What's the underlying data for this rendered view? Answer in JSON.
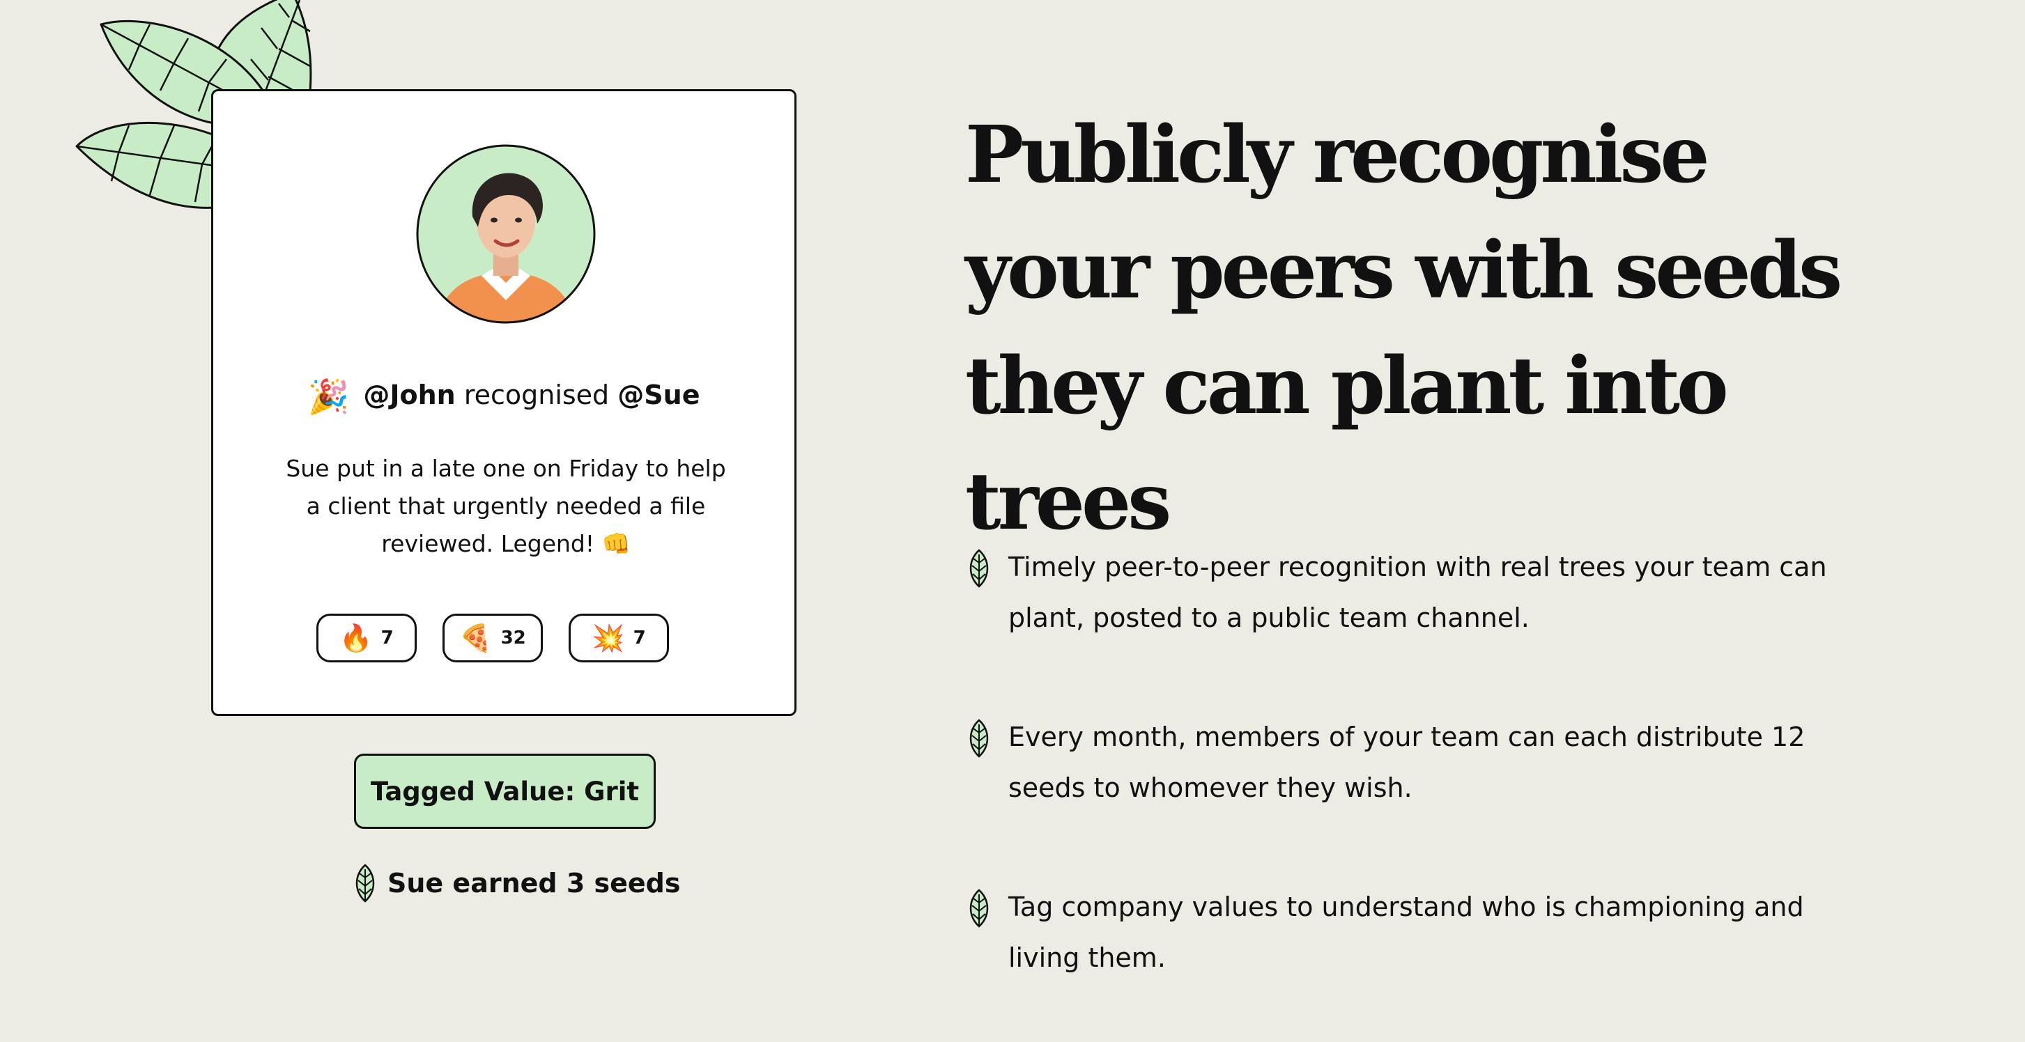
{
  "recognition_card": {
    "giver": "@John",
    "verb": "recognised",
    "receiver": "@Sue",
    "party_emoji": "🎉",
    "message": "Sue put in a late one on Friday to help a client that urgently needed a file reviewed. Legend! 👊",
    "reactions": [
      {
        "emoji": "🔥",
        "count": "7"
      },
      {
        "emoji": "🍕",
        "count": "32"
      },
      {
        "emoji": "💥",
        "count": "7"
      }
    ]
  },
  "tagged_value_label": "Tagged Value: Grit",
  "seeds_earned_text": "Sue earned 3 seeds",
  "headline": "Publicly recognise your peers with seeds they can plant into trees",
  "features": [
    {
      "icon": "leaf-icon",
      "text": "Timely peer-to-peer recognition with real trees your team can plant, posted to a public team channel."
    },
    {
      "icon": "leaf-icon",
      "text": "Every month, members of your team can each distribute 12 seeds to whomever they wish."
    },
    {
      "icon": "leaf-icon",
      "text": "Tag company values to understand who is championing and living them."
    }
  ],
  "colors": {
    "background": "#edece4",
    "leaf_green": "#c8ecc6",
    "ink": "#111111",
    "avatar_shirt": "#f2914e"
  }
}
